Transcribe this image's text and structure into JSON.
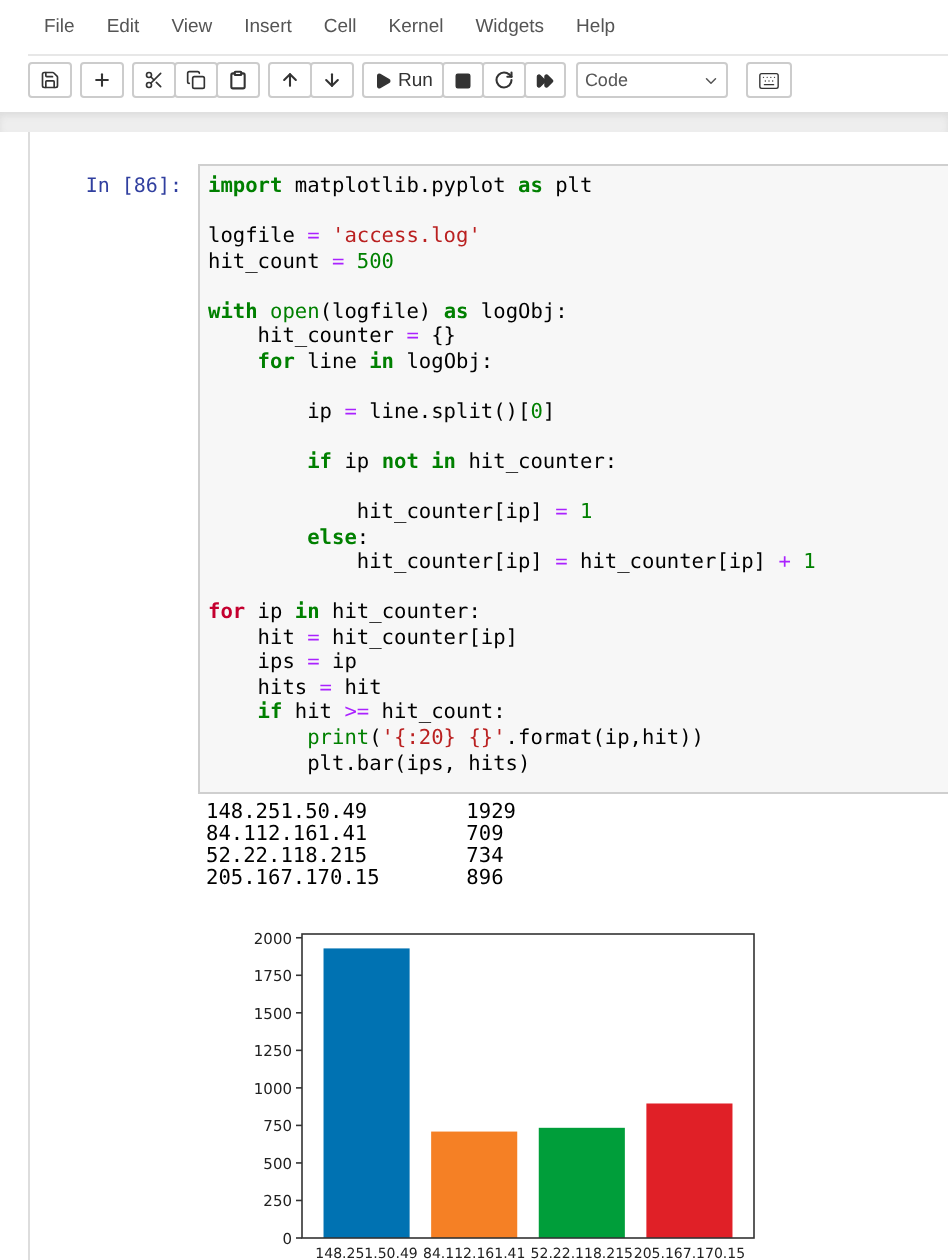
{
  "menu": [
    "File",
    "Edit",
    "View",
    "Insert",
    "Cell",
    "Kernel",
    "Widgets",
    "Help"
  ],
  "toolbar": {
    "run_label": "Run",
    "cell_type": "Code"
  },
  "cell": {
    "prompt": "In [86]:",
    "lines": [
      {
        "kind": "code",
        "tokens": [
          {
            "kind": "kw",
            "t": "import"
          },
          {
            "kind": "plain",
            "t": " matplotlib.pyplot "
          },
          {
            "kind": "kw",
            "t": "as"
          },
          {
            "kind": "plain",
            "t": " plt"
          }
        ]
      },
      {
        "kind": "blank"
      },
      {
        "kind": "code",
        "tokens": [
          {
            "kind": "plain",
            "t": "logfile "
          },
          {
            "kind": "op",
            "t": "="
          },
          {
            "kind": "str",
            "t": " 'access.log'"
          }
        ]
      },
      {
        "kind": "code",
        "tokens": [
          {
            "kind": "plain",
            "t": "hit_count "
          },
          {
            "kind": "op",
            "t": "="
          },
          {
            "kind": "num",
            "t": " 500"
          }
        ]
      },
      {
        "kind": "blank"
      },
      {
        "kind": "code",
        "tokens": [
          {
            "kind": "kw",
            "t": "with"
          },
          {
            "kind": "builtin",
            "t": " open"
          },
          {
            "kind": "plain",
            "t": "(logfile) "
          },
          {
            "kind": "kw",
            "t": "as"
          },
          {
            "kind": "plain",
            "t": " logObj:"
          }
        ]
      },
      {
        "kind": "code",
        "tokens": [
          {
            "kind": "plain",
            "t": "    hit_counter "
          },
          {
            "kind": "op",
            "t": "="
          },
          {
            "kind": "plain",
            "t": " {}"
          }
        ]
      },
      {
        "kind": "code",
        "tokens": [
          {
            "kind": "kw",
            "t": "    for"
          },
          {
            "kind": "plain",
            "t": " line "
          },
          {
            "kind": "kw",
            "t": "in"
          },
          {
            "kind": "plain",
            "t": " logObj:"
          }
        ]
      },
      {
        "kind": "blank"
      },
      {
        "kind": "code",
        "tokens": [
          {
            "kind": "plain",
            "t": "        ip "
          },
          {
            "kind": "op",
            "t": "="
          },
          {
            "kind": "plain",
            "t": " line.split()["
          },
          {
            "kind": "num",
            "t": "0"
          },
          {
            "kind": "plain",
            "t": "]"
          }
        ]
      },
      {
        "kind": "blank"
      },
      {
        "kind": "code",
        "tokens": [
          {
            "kind": "kw",
            "t": "        if"
          },
          {
            "kind": "plain",
            "t": " ip "
          },
          {
            "kind": "kw",
            "t": "not in"
          },
          {
            "kind": "plain",
            "t": " hit_counter:"
          }
        ]
      },
      {
        "kind": "blank"
      },
      {
        "kind": "code",
        "tokens": [
          {
            "kind": "plain",
            "t": "            hit_counter[ip] "
          },
          {
            "kind": "op",
            "t": "="
          },
          {
            "kind": "num",
            "t": " 1"
          }
        ]
      },
      {
        "kind": "code",
        "tokens": [
          {
            "kind": "kw",
            "t": "        else"
          },
          {
            "kind": "plain",
            "t": ":"
          }
        ]
      },
      {
        "kind": "code",
        "tokens": [
          {
            "kind": "plain",
            "t": "            hit_counter[ip] "
          },
          {
            "kind": "op",
            "t": "="
          },
          {
            "kind": "plain",
            "t": " hit_counter[ip] "
          },
          {
            "kind": "op",
            "t": "+"
          },
          {
            "kind": "num",
            "t": " 1"
          }
        ]
      },
      {
        "kind": "blank"
      },
      {
        "kind": "code",
        "tokens": [
          {
            "kind": "kwred",
            "t": "for"
          },
          {
            "kind": "plain",
            "t": " ip "
          },
          {
            "kind": "kw",
            "t": "in"
          },
          {
            "kind": "plain",
            "t": " hit_counter:"
          }
        ]
      },
      {
        "kind": "code",
        "tokens": [
          {
            "kind": "plain",
            "t": "    hit "
          },
          {
            "kind": "op",
            "t": "="
          },
          {
            "kind": "plain",
            "t": " hit_counter[ip]"
          }
        ]
      },
      {
        "kind": "code",
        "tokens": [
          {
            "kind": "plain",
            "t": "    ips "
          },
          {
            "kind": "op",
            "t": "="
          },
          {
            "kind": "plain",
            "t": " ip"
          }
        ]
      },
      {
        "kind": "code",
        "tokens": [
          {
            "kind": "plain",
            "t": "    hits "
          },
          {
            "kind": "op",
            "t": "="
          },
          {
            "kind": "plain",
            "t": " hit"
          }
        ]
      },
      {
        "kind": "code",
        "tokens": [
          {
            "kind": "kw",
            "t": "    if"
          },
          {
            "kind": "plain",
            "t": " hit "
          },
          {
            "kind": "op",
            "t": ">="
          },
          {
            "kind": "plain",
            "t": " hit_count:"
          }
        ]
      },
      {
        "kind": "code",
        "tokens": [
          {
            "kind": "builtin",
            "t": "        print"
          },
          {
            "kind": "plain",
            "t": "("
          },
          {
            "kind": "str",
            "t": "'{:20} {}'"
          },
          {
            "kind": "plain",
            "t": ".format(ip,hit))"
          }
        ]
      },
      {
        "kind": "code",
        "tokens": [
          {
            "kind": "plain",
            "t": "        plt.bar(ips, hits)"
          }
        ]
      }
    ],
    "output": [
      "148.251.50.49        1929",
      "84.112.161.41        709",
      "52.22.118.215        734",
      "205.167.170.15       896"
    ],
    "chart_data": {
      "type": "bar",
      "categories": [
        "148.251.50.49",
        "84.112.161.41",
        "52.22.118.215",
        "205.167.170.15"
      ],
      "series": [
        {
          "color": "#0072b2",
          "values": [
            1929,
            null,
            null,
            null
          ]
        },
        {
          "color": "#f58025",
          "values": [
            null,
            709,
            null,
            null
          ]
        },
        {
          "color": "#009e3a",
          "values": [
            null,
            null,
            734,
            null
          ]
        },
        {
          "color": "#e02027",
          "values": [
            null,
            null,
            null,
            896
          ]
        }
      ],
      "ylim": [
        0,
        2025
      ],
      "yticks": [
        0,
        250,
        500,
        750,
        1000,
        1250,
        1500,
        1750,
        2000
      ]
    }
  }
}
